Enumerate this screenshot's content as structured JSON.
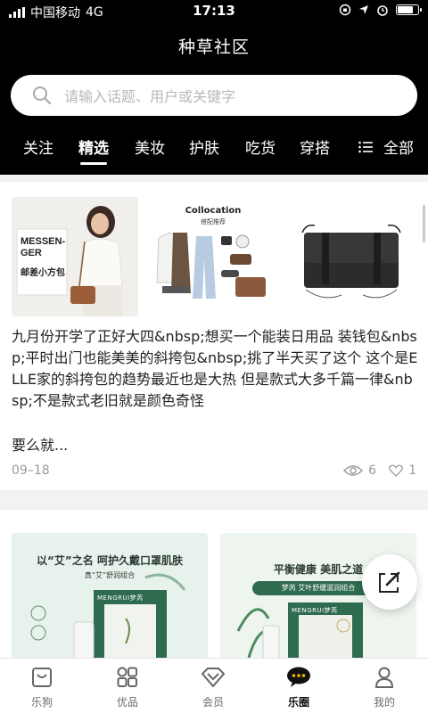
{
  "status_bar": {
    "carrier": "中国移动",
    "network": "4G",
    "time": "17:13"
  },
  "header": {
    "title": "种草社区",
    "search_placeholder": "请输入话题、用户或关键字",
    "tabs": [
      "关注",
      "精选",
      "美妆",
      "护肤",
      "吃货",
      "穿搭"
    ],
    "active_tab": "精选",
    "all_label": "全部"
  },
  "post": {
    "img1_lines": [
      "MESSEN-",
      "GER"
    ],
    "img1_sub": "邮差小方包",
    "img2_title": "Collocation",
    "img2_sub": "搭配推荐",
    "text": "九月份开学了正好大四&nbsp;想买一个能装日用品 装钱包&nbsp;平时出门也能美美的斜挎包&nbsp;挑了半天买了这个 这个是ELLE家的斜挎包的趋势最近也是大热 但是款式大多千篇一律&nbsp;不是款式老旧就是颜色奇怪",
    "more": "要么就...",
    "date": "09–18",
    "views": "6",
    "likes": "1"
  },
  "promos": [
    {
      "headline": "以“艾”之名 呵护久戴口罩肌肤",
      "sub": "真“艾”舒润组合",
      "brand": "MENGRUI梦芮"
    },
    {
      "headline": "平衡健康 美肌之道",
      "sub": "梦芮 艾叶舒缓滋润组合",
      "brand": "MENGRUI梦芮"
    }
  ],
  "nav": [
    {
      "label": "乐狗",
      "icon": "bag-icon"
    },
    {
      "label": "优品",
      "icon": "grid-icon"
    },
    {
      "label": "会员",
      "icon": "diamond-icon"
    },
    {
      "label": "乐圈",
      "icon": "chat-bubble-icon"
    },
    {
      "label": "我的",
      "icon": "person-icon"
    }
  ],
  "active_nav": "乐圈",
  "colors": {
    "header_bg": "#000000",
    "background": "#f2f2f2",
    "promo_green": "#2f6b4f"
  }
}
